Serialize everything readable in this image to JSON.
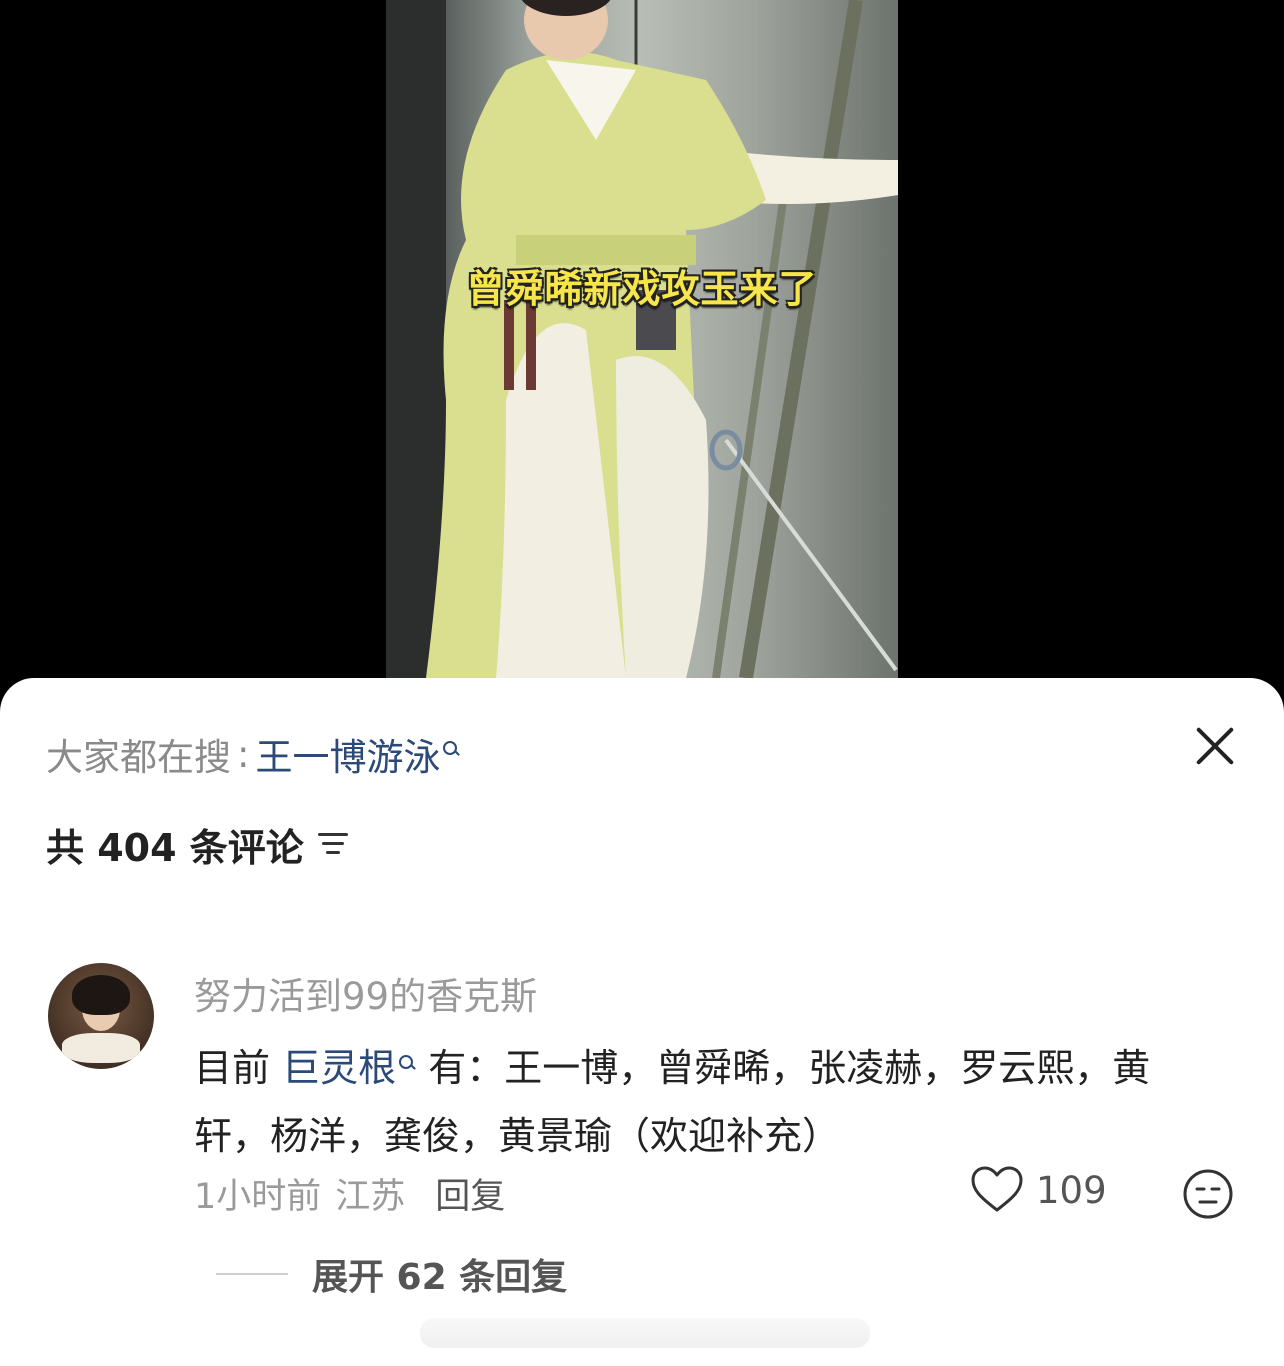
{
  "video": {
    "caption": "曾舜晞新戏攻玉来了"
  },
  "search": {
    "prefix": "大家都在搜",
    "separator": ":",
    "term": "王一博游泳"
  },
  "comments_header": {
    "count_label": "共 404 条评论"
  },
  "comment": {
    "username": "努力活到99的香克斯",
    "text_before": "目前 ",
    "link": "巨灵根",
    "text_after": " 有：王一博，曾舜晞，张凌赫，罗云熙，黄轩，杨洋，龚俊，黄景瑜（欢迎补充）",
    "time": "1小时前",
    "location": "江苏",
    "reply_label": "回复",
    "like_count": "109",
    "expand_replies": "展开 62 条回复"
  },
  "colors": {
    "link": "#2c4a78",
    "caption": "#f7e64a"
  }
}
